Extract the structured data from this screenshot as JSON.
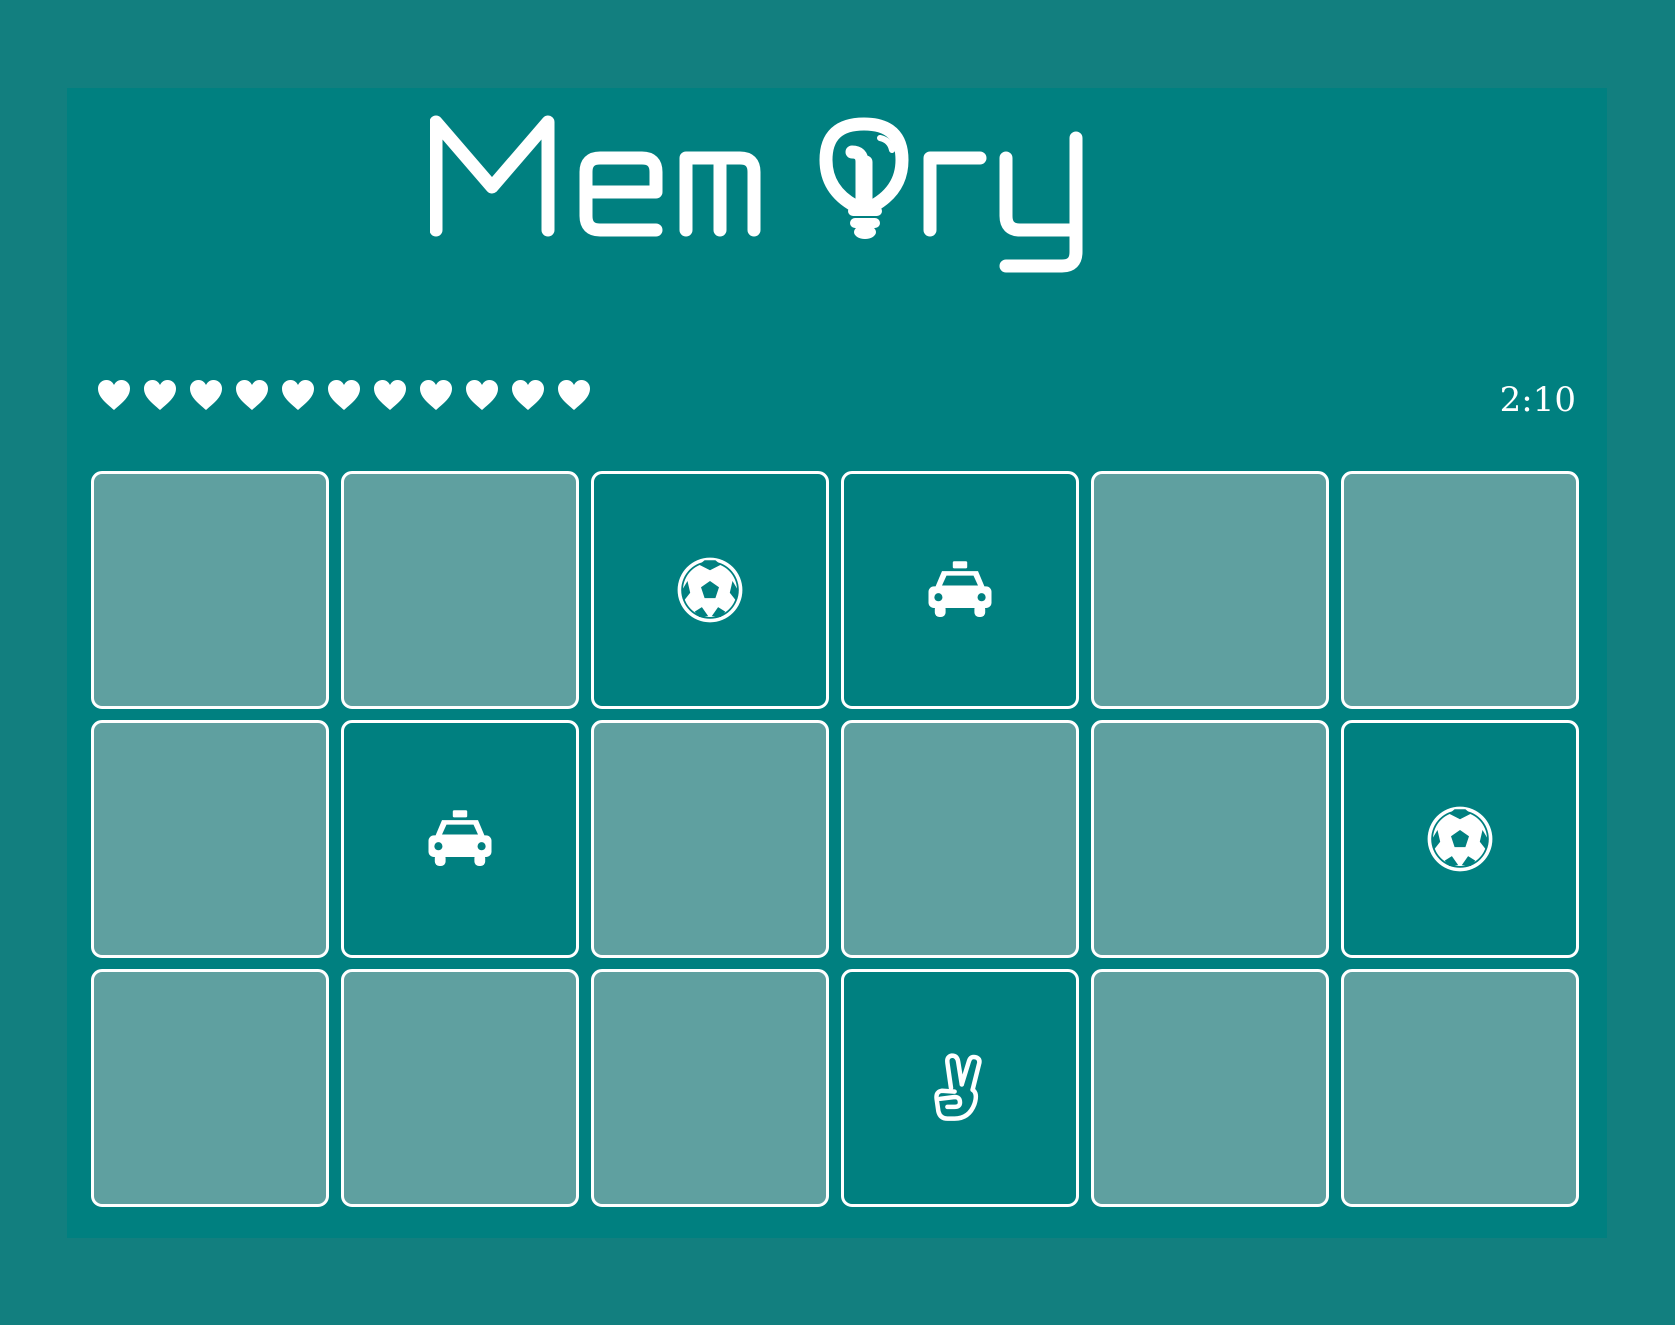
{
  "game": {
    "title": "Memory",
    "timer": "2:10",
    "lives": 11
  },
  "colors": {
    "background": "#127f7f",
    "panel": "#008080",
    "card_back": "#5fa0a0",
    "card_front": "#008080",
    "foreground": "#ffffff"
  },
  "board": {
    "rows": 3,
    "columns": 6,
    "cards": [
      {
        "state": "hidden",
        "icon": ""
      },
      {
        "state": "hidden",
        "icon": ""
      },
      {
        "state": "revealed",
        "icon": "soccer-ball-icon"
      },
      {
        "state": "revealed",
        "icon": "taxi-icon"
      },
      {
        "state": "hidden",
        "icon": ""
      },
      {
        "state": "hidden",
        "icon": ""
      },
      {
        "state": "hidden",
        "icon": ""
      },
      {
        "state": "revealed",
        "icon": "taxi-icon"
      },
      {
        "state": "hidden",
        "icon": ""
      },
      {
        "state": "hidden",
        "icon": ""
      },
      {
        "state": "hidden",
        "icon": ""
      },
      {
        "state": "revealed",
        "icon": "soccer-ball-icon"
      },
      {
        "state": "hidden",
        "icon": ""
      },
      {
        "state": "hidden",
        "icon": ""
      },
      {
        "state": "hidden",
        "icon": ""
      },
      {
        "state": "revealed",
        "icon": "peace-hand-icon"
      },
      {
        "state": "hidden",
        "icon": ""
      },
      {
        "state": "hidden",
        "icon": ""
      }
    ]
  }
}
